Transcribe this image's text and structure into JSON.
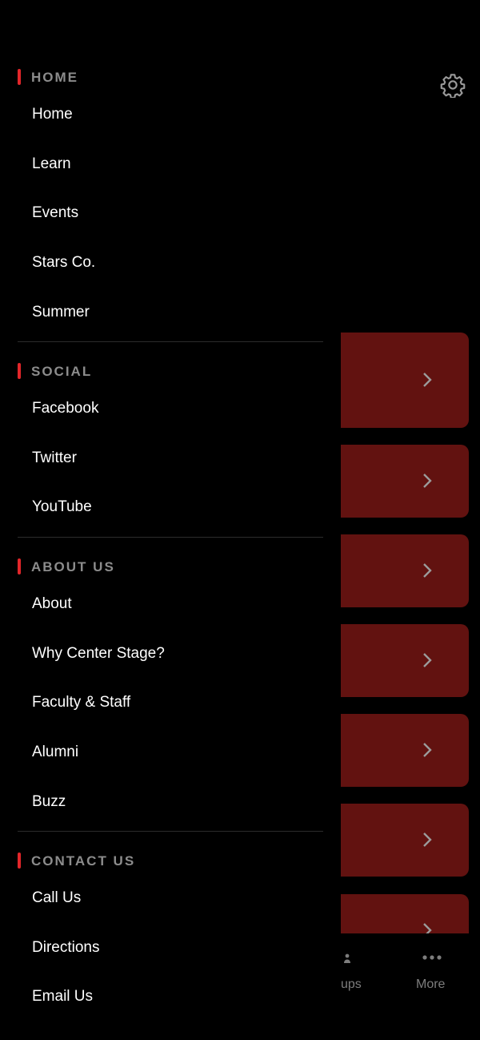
{
  "drawer": {
    "sections": [
      {
        "title": "HOME",
        "items": [
          "Home",
          "Learn",
          "Events",
          "Stars Co.",
          "Summer"
        ]
      },
      {
        "title": "SOCIAL",
        "items": [
          "Facebook",
          "Twitter",
          "YouTube"
        ]
      },
      {
        "title": "ABOUT US",
        "items": [
          "About",
          "Why Center Stage?",
          "Faculty & Staff",
          "Alumni",
          "Buzz"
        ]
      },
      {
        "title": "CONTACT US",
        "items": [
          "Call Us",
          "Directions",
          "Email Us"
        ]
      }
    ]
  },
  "background": {
    "settings_icon": "gear-icon",
    "card_color": "#621210",
    "chevron_icon": "chevron-right-icon"
  },
  "tabbar": {
    "groups_label_partial": "ups",
    "more_label": "More",
    "more_icon": "more-dots-icon"
  },
  "colors": {
    "accent": "#e2262a",
    "header_text": "#8c8c8c",
    "item_text": "#ffffff",
    "tab_text": "#7d7d7d"
  }
}
